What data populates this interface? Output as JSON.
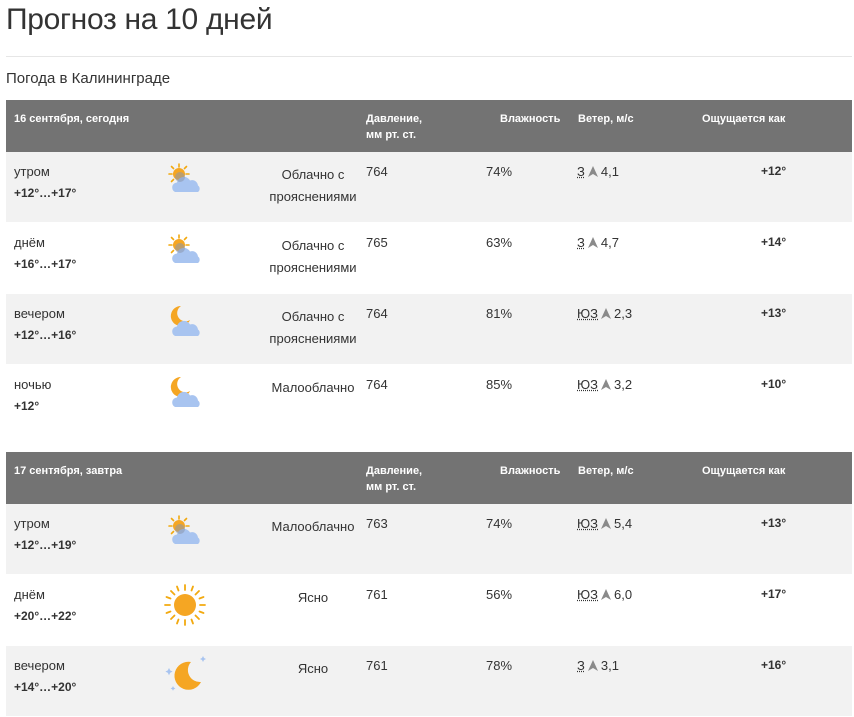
{
  "page": {
    "title": "Прогноз на 10 дней",
    "location": "Погода в Калининграде"
  },
  "headers": {
    "pressure_line1": "Давление,",
    "pressure_line2": "мм рт. ст.",
    "humidity": "Влажность",
    "wind": "Ветер, м/с",
    "feels": "Ощущается как"
  },
  "days": [
    {
      "date": "16 сентября, сегодня",
      "rows": [
        {
          "period": "утром",
          "temps": "+12°…+17°",
          "icon": "partly-cloudy-day-icon",
          "cond_line1": "Облачно с",
          "cond_line2": "прояснениями",
          "pressure": "764",
          "humidity": "74%",
          "wind_dir": "З",
          "wind_speed": "4,1",
          "feels": "+12°"
        },
        {
          "period": "днём",
          "temps": "+16°…+17°",
          "icon": "partly-cloudy-day-icon",
          "cond_line1": "Облачно с",
          "cond_line2": "прояснениями",
          "pressure": "765",
          "humidity": "63%",
          "wind_dir": "З",
          "wind_speed": "4,7",
          "feels": "+14°"
        },
        {
          "period": "вечером",
          "temps": "+12°…+16°",
          "icon": "partly-cloudy-night-icon",
          "cond_line1": "Облачно с",
          "cond_line2": "прояснениями",
          "pressure": "764",
          "humidity": "81%",
          "wind_dir": "ЮЗ",
          "wind_speed": "2,3",
          "feels": "+13°"
        },
        {
          "period": "ночью",
          "temps": "+12°",
          "icon": "partly-cloudy-night-icon",
          "cond_line1": "Малооблачно",
          "cond_line2": "",
          "pressure": "764",
          "humidity": "85%",
          "wind_dir": "ЮЗ",
          "wind_speed": "3,2",
          "feels": "+10°"
        }
      ]
    },
    {
      "date": "17 сентября, завтра",
      "rows": [
        {
          "period": "утром",
          "temps": "+12°…+19°",
          "icon": "partly-cloudy-day-icon",
          "cond_line1": "Малооблачно",
          "cond_line2": "",
          "pressure": "763",
          "humidity": "74%",
          "wind_dir": "ЮЗ",
          "wind_speed": "5,4",
          "feels": "+13°"
        },
        {
          "period": "днём",
          "temps": "+20°…+22°",
          "icon": "sun-icon",
          "cond_line1": "Ясно",
          "cond_line2": "",
          "pressure": "761",
          "humidity": "56%",
          "wind_dir": "ЮЗ",
          "wind_speed": "6,0",
          "feels": "+17°"
        },
        {
          "period": "вечером",
          "temps": "+14°…+20°",
          "icon": "clear-night-icon",
          "cond_line1": "Ясно",
          "cond_line2": "",
          "pressure": "761",
          "humidity": "78%",
          "wind_dir": "З",
          "wind_speed": "3,1",
          "feels": "+16°"
        }
      ]
    }
  ]
}
